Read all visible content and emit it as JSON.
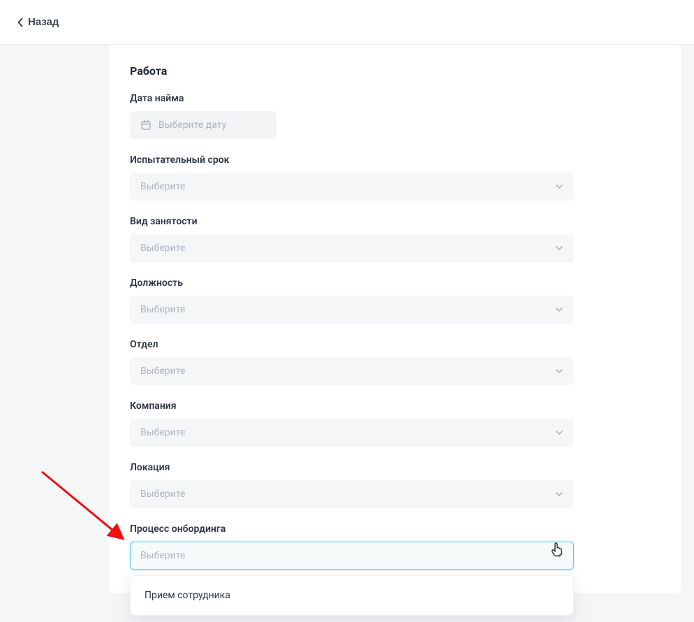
{
  "topbar": {
    "back_label": "Назад"
  },
  "section": {
    "title": "Работа"
  },
  "fields": {
    "hire_date": {
      "label": "Дата найма",
      "placeholder": "Выберите дату"
    },
    "probation": {
      "label": "Испытательный срок",
      "placeholder": "Выберите"
    },
    "employment_type": {
      "label": "Вид занятости",
      "placeholder": "Выберите"
    },
    "position": {
      "label": "Должность",
      "placeholder": "Выберите"
    },
    "department": {
      "label": "Отдел",
      "placeholder": "Выберите"
    },
    "company": {
      "label": "Компания",
      "placeholder": "Выберите"
    },
    "location": {
      "label": "Локация",
      "placeholder": "Выберите"
    },
    "onboarding": {
      "label": "Процесс онбординга",
      "placeholder": "Выберите",
      "options": [
        "Прием сотрудника"
      ]
    }
  }
}
